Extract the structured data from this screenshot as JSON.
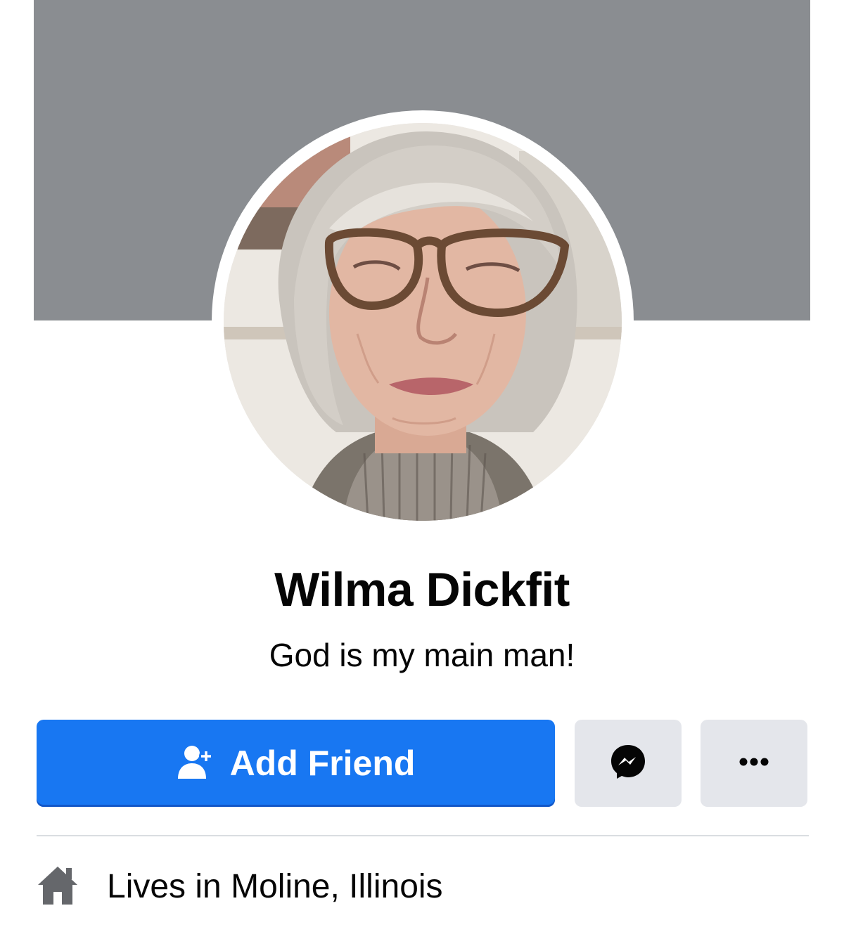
{
  "profile": {
    "name": "Wilma Dickfit",
    "bio": "God is my main man!"
  },
  "actions": {
    "add_friend_label": "Add Friend",
    "add_friend_icon": "add-friend-icon",
    "message_icon": "messenger-icon",
    "more_icon": "more-options-icon"
  },
  "intro": {
    "lives_prefix": "Lives in ",
    "lives_place": "Moline, Illinois",
    "home_icon": "home-icon"
  },
  "colors": {
    "cover": "#8a8d91",
    "primary_button": "#1877f2",
    "secondary_button": "#e4e6eb",
    "text": "#050505"
  }
}
